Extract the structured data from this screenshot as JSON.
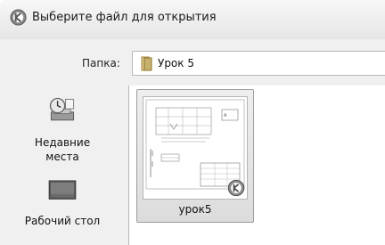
{
  "window": {
    "title": "Выберите файл для открытия",
    "icon": "autocad-logo-icon"
  },
  "toolbar": {
    "folder_label": "Папка:",
    "folder_value": "Урок 5",
    "folder_icon": "folder-icon"
  },
  "places": [
    {
      "label": "Недавние места",
      "icon": "recent-places-icon"
    },
    {
      "label": "Рабочий стол",
      "icon": "desktop-icon"
    }
  ],
  "files": [
    {
      "name": "урок5",
      "icon": "dwg-thumbnail",
      "selected": true
    }
  ],
  "colors": {
    "selection_bg": "#dcdcdc",
    "window_bg": "#f0f0f0"
  }
}
